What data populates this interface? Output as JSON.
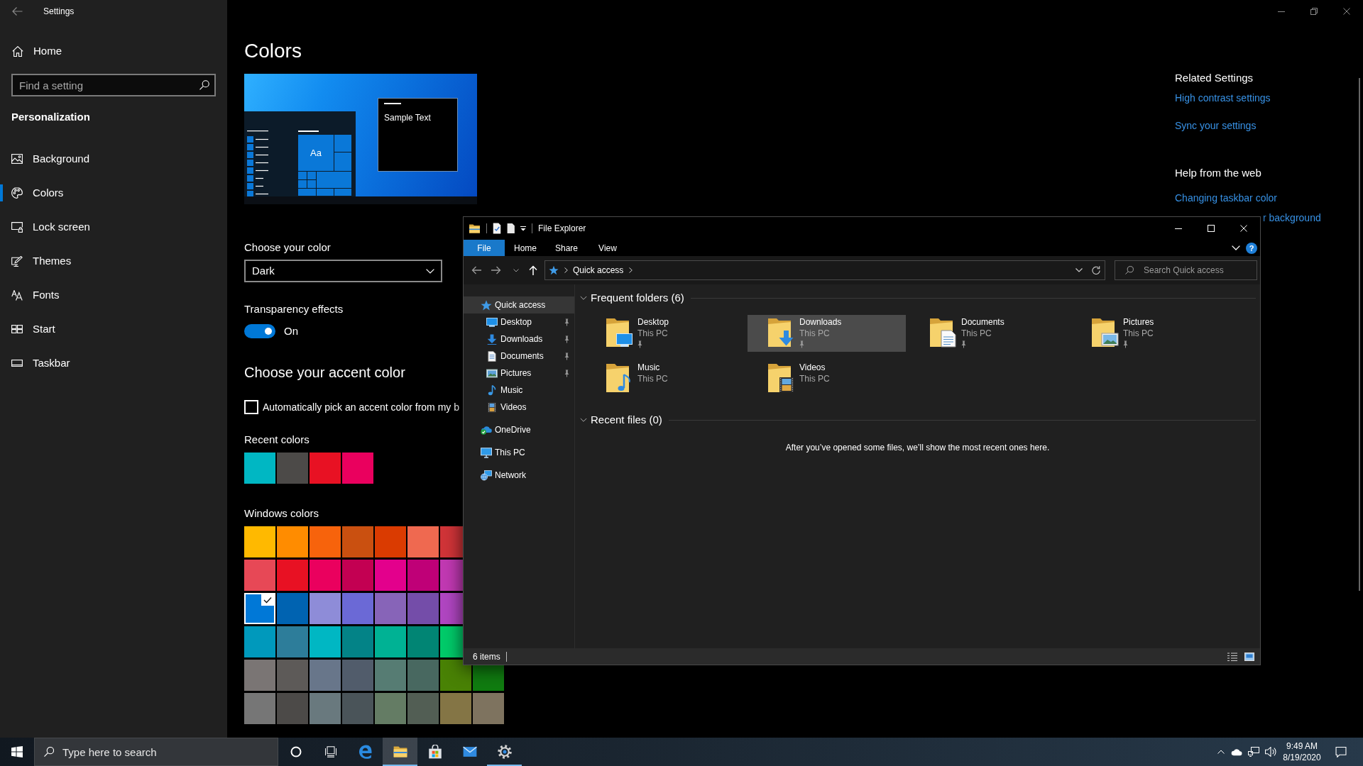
{
  "settings": {
    "title": "Settings",
    "sidebar": {
      "home": "Home",
      "search": {
        "placeholder": "Find a setting"
      },
      "section": "Personalization",
      "items": [
        {
          "label": "Background",
          "selected": false
        },
        {
          "label": "Colors",
          "selected": true
        },
        {
          "label": "Lock screen",
          "selected": false
        },
        {
          "label": "Themes",
          "selected": false
        },
        {
          "label": "Fonts",
          "selected": false
        },
        {
          "label": "Start",
          "selected": false
        },
        {
          "label": "Taskbar",
          "selected": false
        }
      ]
    },
    "page": {
      "title": "Colors",
      "preview": {
        "tile_text": "Aa",
        "window_text": "Sample Text"
      },
      "color_mode": {
        "label": "Choose your color",
        "value": "Dark"
      },
      "transparency": {
        "label": "Transparency effects",
        "on": true,
        "state_text": "On"
      },
      "accent_title": "Choose your accent color",
      "auto_pick": {
        "label": "Automatically pick an accent color from my b",
        "checked": false
      },
      "recent_colors": {
        "label": "Recent colors",
        "swatches": [
          {
            "color": "#00b7c3"
          },
          {
            "color": "#4c4a48"
          },
          {
            "color": "#e81123"
          },
          {
            "color": "#ea005e"
          }
        ]
      },
      "windows_colors": {
        "label": "Windows colors",
        "rows": [
          [
            {
              "color": "#ffb900",
              "selected": false
            },
            {
              "color": "#ff8c00",
              "selected": false
            },
            {
              "color": "#f7630c",
              "selected": false
            },
            {
              "color": "#ca5010",
              "selected": false
            },
            {
              "color": "#da3b01",
              "selected": false
            },
            {
              "color": "#ef6950",
              "selected": false
            },
            {
              "color": "#d13438",
              "selected": false
            }
          ],
          [
            {
              "color": "#e74856",
              "selected": false
            },
            {
              "color": "#e81123",
              "selected": false
            },
            {
              "color": "#ea005e",
              "selected": false
            },
            {
              "color": "#c30052",
              "selected": false
            },
            {
              "color": "#e3008c",
              "selected": false
            },
            {
              "color": "#bf0077",
              "selected": false
            },
            {
              "color": "#c239b3",
              "selected": false
            }
          ],
          [
            {
              "color": "#0078d7",
              "selected": true
            },
            {
              "color": "#0063b1",
              "selected": false
            },
            {
              "color": "#8e8cd8",
              "selected": false
            },
            {
              "color": "#6b69d6",
              "selected": false
            },
            {
              "color": "#8764b8",
              "selected": false
            },
            {
              "color": "#744da9",
              "selected": false
            },
            {
              "color": "#b146c2",
              "selected": false
            }
          ],
          [
            {
              "color": "#0099bc",
              "selected": false
            },
            {
              "color": "#2d7d9a",
              "selected": false
            },
            {
              "color": "#00b7c3",
              "selected": false
            },
            {
              "color": "#038387",
              "selected": false
            },
            {
              "color": "#00b294",
              "selected": false
            },
            {
              "color": "#018574",
              "selected": false
            },
            {
              "color": "#00cc6a",
              "selected": false
            }
          ],
          [
            {
              "color": "#7a7574",
              "selected": false
            },
            {
              "color": "#5d5a58",
              "selected": false
            },
            {
              "color": "#68768a",
              "selected": false
            },
            {
              "color": "#515c6b",
              "selected": false
            },
            {
              "color": "#567c73",
              "selected": false
            },
            {
              "color": "#486860",
              "selected": false
            },
            {
              "color": "#498205",
              "selected": false
            },
            {
              "color": "#107c10",
              "selected": false
            }
          ],
          [
            {
              "color": "#767676",
              "selected": false
            },
            {
              "color": "#4c4a48",
              "selected": false
            },
            {
              "color": "#69797e",
              "selected": false
            },
            {
              "color": "#4a5459",
              "selected": false
            },
            {
              "color": "#647c64",
              "selected": false
            },
            {
              "color": "#525e54",
              "selected": false
            },
            {
              "color": "#847545",
              "selected": false
            },
            {
              "color": "#7e735f",
              "selected": false
            }
          ]
        ]
      }
    },
    "related": {
      "title": "Related Settings",
      "links": [
        "High contrast settings",
        "Sync your settings"
      ]
    },
    "help": {
      "title": "Help from the web",
      "links": [
        {
          "text": "Changing taskbar color",
          "kind": "full"
        },
        {
          "text": "r background",
          "kind": "covered"
        }
      ]
    }
  },
  "file_explorer": {
    "title": "File Explorer",
    "ribbon": {
      "tabs": [
        {
          "label": "File",
          "kind": "menu"
        },
        {
          "label": "Home",
          "kind": "tab"
        },
        {
          "label": "Share",
          "kind": "tab"
        },
        {
          "label": "View",
          "kind": "tab"
        }
      ],
      "help": "?"
    },
    "address": {
      "path": [
        "Quick access"
      ]
    },
    "search": {
      "placeholder": "Search Quick access"
    },
    "nav": [
      {
        "label": "Quick access",
        "selected": true,
        "children": [
          {
            "label": "Desktop",
            "selected": false,
            "pinned": true
          },
          {
            "label": "Downloads",
            "selected": false,
            "pinned": true
          },
          {
            "label": "Documents",
            "selected": false,
            "pinned": true
          },
          {
            "label": "Pictures",
            "selected": false,
            "pinned": true
          },
          {
            "label": "Music",
            "selected": false,
            "pinned": false
          },
          {
            "label": "Videos",
            "selected": false,
            "pinned": false
          }
        ]
      },
      {
        "label": "OneDrive",
        "selected": false
      },
      {
        "label": "This PC",
        "selected": false
      },
      {
        "label": "Network",
        "selected": false
      }
    ],
    "groups": [
      {
        "title": "Frequent folders (6)",
        "expanded": true,
        "folders": [
          {
            "name": "Desktop",
            "location": "This PC",
            "pinned": true,
            "selected": false
          },
          {
            "name": "Downloads",
            "location": "This PC",
            "pinned": true,
            "selected": true
          },
          {
            "name": "Documents",
            "location": "This PC",
            "pinned": true,
            "selected": false
          },
          {
            "name": "Pictures",
            "location": "This PC",
            "pinned": true,
            "selected": false
          },
          {
            "name": "Music",
            "location": "This PC",
            "pinned": false,
            "selected": false
          },
          {
            "name": "Videos",
            "location": "This PC",
            "pinned": false,
            "selected": false
          }
        ]
      },
      {
        "title": "Recent files (0)",
        "expanded": true,
        "empty_text": "After you’ve opened some files, we’ll show the most recent ones here."
      }
    ],
    "status": {
      "count": "6 items"
    }
  },
  "taskbar": {
    "search": {
      "placeholder": "Type here to search"
    },
    "apps": [
      {
        "running": false,
        "focused": false
      },
      {
        "running": true,
        "focused": true
      },
      {
        "running": false,
        "focused": false
      },
      {
        "running": false,
        "focused": false
      },
      {
        "running": true,
        "focused": false
      }
    ],
    "clock": {
      "time": "9:49 AM",
      "date": "8/19/2020"
    }
  }
}
